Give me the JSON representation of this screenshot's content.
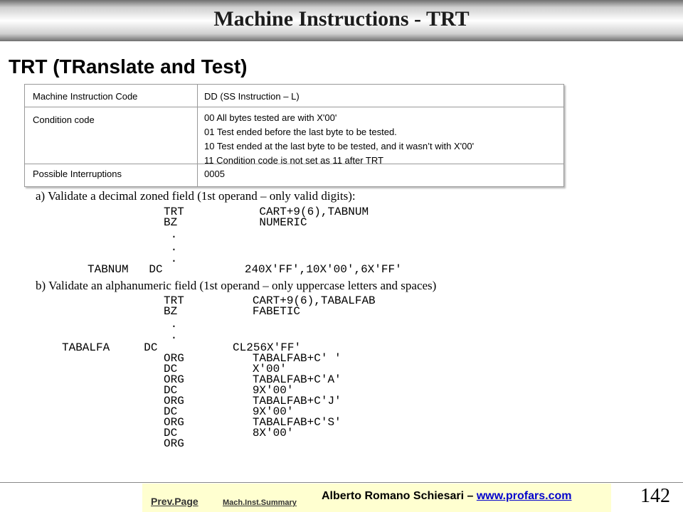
{
  "title": "Machine Instructions - TRT",
  "subtitle": "TRT (TRanslate and Test)",
  "table": {
    "rows": [
      {
        "label": "Machine Instruction Code",
        "value": "DD (SS Instruction – L)"
      },
      {
        "label": "Condition code",
        "lines": [
          "00  All bytes tested are with X'00'",
          "01  Test ended before the last byte to be tested.",
          "10  Test ended at the last byte to be tested, and it wasn’t with X'00'",
          "11  Condition code is not set as 11 after  TRT"
        ]
      },
      {
        "label": "Possible Interruptions",
        "value": "0005"
      }
    ]
  },
  "sections": [
    {
      "heading": "a) Validate a decimal zoned field (1st operand – only valid digits):",
      "lines": [
        "TRT           CART+9(6),TABNUM",
        "BZ            NUMERIC",
        " .",
        " .",
        " .",
        "TABNUM   DC            240X'FF',10X'00',6X'FF'"
      ]
    },
    {
      "heading": "b) Validate an alphanumeric field (1st operand – only uppercase letters and spaces)",
      "lines": [
        "TRT          CART+9(6),TABALFAB",
        "BZ           FABETIC",
        " .",
        " .",
        "TABALFA     DC           CL256X'FF'",
        "ORG          TABALFAB+C' '",
        "DC           X'00'",
        "ORG          TABALFAB+C'A'",
        "DC           9X'00'",
        "ORG          TABALFAB+C'J'",
        "DC           9X'00'",
        "ORG          TABALFAB+C'S'",
        "DC           8X'00'",
        "ORG"
      ]
    }
  ],
  "footer": {
    "prev": "Prev.Page",
    "summary": "Mach.Inst.Summary",
    "author": "Alberto Romano Schiesari – ",
    "website": "www.profars.com",
    "page": "142"
  }
}
